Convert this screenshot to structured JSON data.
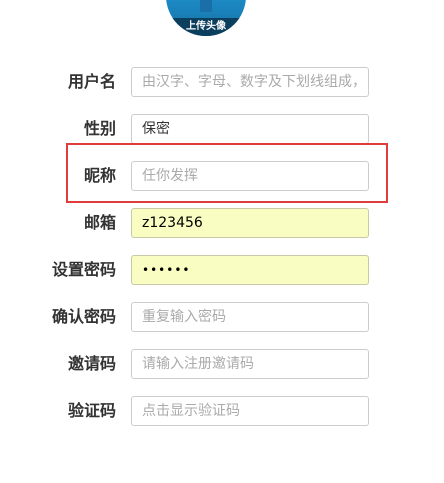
{
  "avatar": {
    "caption": "上传头像"
  },
  "form": {
    "username": {
      "label": "用户名",
      "placeholder": "由汉字、字母、数字及下划线组成，"
    },
    "gender": {
      "label": "性别",
      "value": "保密"
    },
    "nickname": {
      "label": "昵称",
      "placeholder": "任你发挥"
    },
    "email": {
      "label": "邮箱",
      "value": "z123456"
    },
    "password": {
      "label": "设置密码",
      "value": "••••••"
    },
    "confirm_password": {
      "label": "确认密码",
      "placeholder": "重复输入密码"
    },
    "invite_code": {
      "label": "邀请码",
      "placeholder": "请输入注册邀请码"
    },
    "captcha": {
      "label": "验证码",
      "placeholder": "点击显示验证码"
    }
  },
  "colors": {
    "highlight_border": "#e03c3c",
    "autofill_background": "#fafdc1"
  }
}
